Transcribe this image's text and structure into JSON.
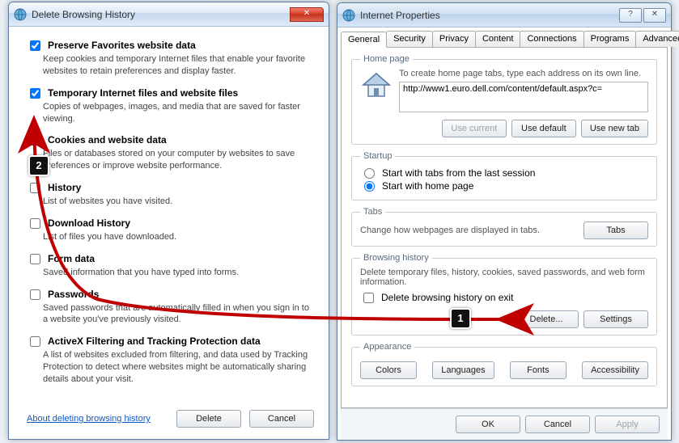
{
  "dbh": {
    "title": "Delete Browsing History",
    "options": [
      {
        "checked": true,
        "title": "Preserve Favorites website data",
        "desc": "Keep cookies and temporary Internet files that enable your favorite websites to retain preferences and display faster."
      },
      {
        "checked": true,
        "title": "Temporary Internet files and website files",
        "desc": "Copies of webpages, images, and media that are saved for faster viewing."
      },
      {
        "checked": true,
        "title": "Cookies and website data",
        "desc": "Files or databases stored on your computer by websites to save preferences or improve website performance."
      },
      {
        "checked": false,
        "title": "History",
        "desc": "List of websites you have visited."
      },
      {
        "checked": false,
        "title": "Download History",
        "desc": "List of files you have downloaded."
      },
      {
        "checked": false,
        "title": "Form data",
        "desc": "Saved information that you have typed into forms."
      },
      {
        "checked": false,
        "title": "Passwords",
        "desc": "Saved passwords that are automatically filled in when you sign in to a website you've previously visited."
      },
      {
        "checked": false,
        "title": "ActiveX Filtering and Tracking Protection data",
        "desc": "A list of websites excluded from filtering, and data used by Tracking Protection to detect where websites might be automatically sharing details about your visit."
      }
    ],
    "about_link": "About deleting browsing history",
    "delete_btn": "Delete",
    "cancel_btn": "Cancel"
  },
  "ip": {
    "title": "Internet Properties",
    "tabs": [
      "General",
      "Security",
      "Privacy",
      "Content",
      "Connections",
      "Programs",
      "Advanced"
    ],
    "active_tab": "General",
    "homepage": {
      "legend": "Home page",
      "text": "To create home page tabs, type each address on its own line.",
      "url": "http://www1.euro.dell.com/content/default.aspx?c=",
      "use_current": "Use current",
      "use_default": "Use default",
      "use_new_tab": "Use new tab"
    },
    "startup": {
      "legend": "Startup",
      "opt1": "Start with tabs from the last session",
      "opt2": "Start with home page",
      "selected": 2
    },
    "tabs_section": {
      "legend": "Tabs",
      "text": "Change how webpages are displayed in tabs.",
      "btn": "Tabs"
    },
    "history": {
      "legend": "Browsing history",
      "text": "Delete temporary files, history, cookies, saved passwords, and web form information.",
      "check_label": "Delete browsing history on exit",
      "delete_btn": "Delete...",
      "settings_btn": "Settings"
    },
    "appearance": {
      "legend": "Appearance",
      "colors": "Colors",
      "languages": "Languages",
      "fonts": "Fonts",
      "accessibility": "Accessibility"
    },
    "footer": {
      "ok": "OK",
      "cancel": "Cancel",
      "apply": "Apply"
    }
  },
  "annotations": {
    "one": "1",
    "two": "2"
  }
}
